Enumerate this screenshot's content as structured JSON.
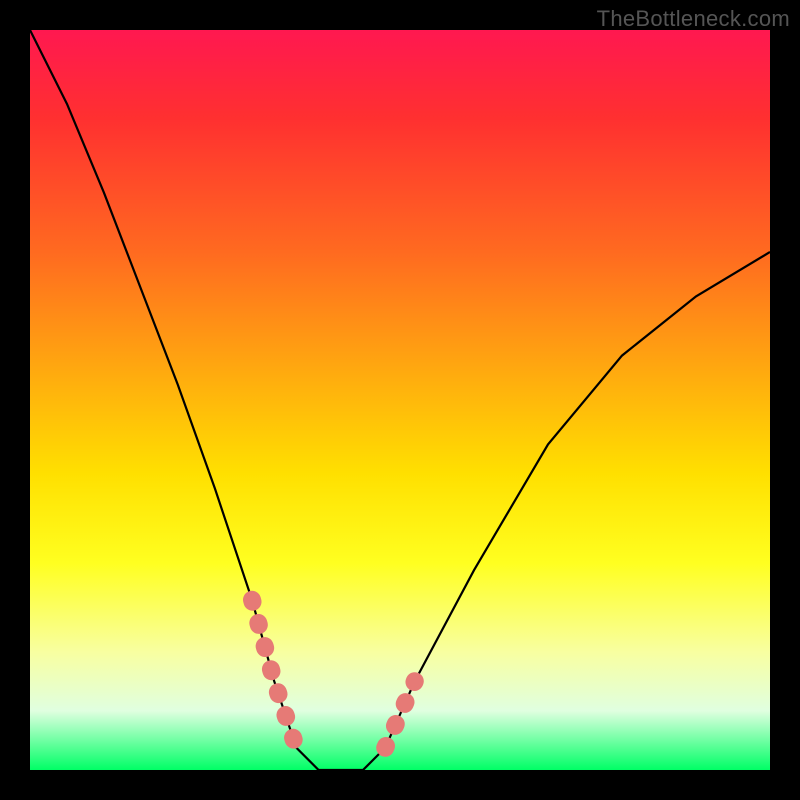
{
  "watermark": "TheBottleneck.com",
  "chart_data": {
    "type": "line",
    "title": "",
    "xlabel": "",
    "ylabel": "",
    "xlim": [
      0,
      100
    ],
    "ylim": [
      0,
      100
    ],
    "x": [
      0,
      5,
      10,
      15,
      20,
      25,
      30,
      33,
      36,
      39,
      42,
      45,
      48,
      52,
      60,
      70,
      80,
      90,
      100
    ],
    "values": [
      100,
      90,
      78,
      65,
      52,
      38,
      23,
      12,
      3,
      0,
      0,
      0,
      3,
      12,
      27,
      44,
      56,
      64,
      70
    ],
    "highlight_ranges_x": [
      [
        30,
        36
      ],
      [
        48,
        54
      ]
    ],
    "annotations": []
  }
}
